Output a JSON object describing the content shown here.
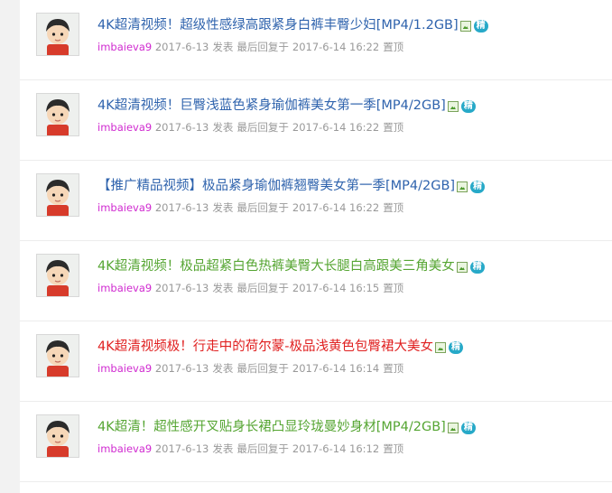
{
  "threads": [
    {
      "title": "4K超清视频！超级性感绿高跟紧身白裤丰臀少妇[MP4/1.2GB]",
      "title_color": "blue",
      "author": "imbaieva9",
      "post_date": "2017-6-13",
      "post_label": "发表",
      "last_reply_label": "最后回复于",
      "last_reply_time": "2017-6-14 16:22",
      "pin_label": "置顶",
      "digest_label": "精"
    },
    {
      "title": "4K超清视频！巨臀浅蓝色紧身瑜伽裤美女第一季[MP4/2GB]",
      "title_color": "blue",
      "author": "imbaieva9",
      "post_date": "2017-6-13",
      "post_label": "发表",
      "last_reply_label": "最后回复于",
      "last_reply_time": "2017-6-14 16:22",
      "pin_label": "置顶",
      "digest_label": "精"
    },
    {
      "title": "【推广精品视频】极品紧身瑜伽裤翘臀美女第一季[MP4/2GB]",
      "title_color": "blue",
      "author": "imbaieva9",
      "post_date": "2017-6-13",
      "post_label": "发表",
      "last_reply_label": "最后回复于",
      "last_reply_time": "2017-6-14 16:22",
      "pin_label": "置顶",
      "digest_label": "精"
    },
    {
      "title": "4K超清视频！极品超紧白色热裤美臀大长腿白高跟美三角美女",
      "title_color": "green",
      "author": "imbaieva9",
      "post_date": "2017-6-13",
      "post_label": "发表",
      "last_reply_label": "最后回复于",
      "last_reply_time": "2017-6-14 16:15",
      "pin_label": "置顶",
      "digest_label": "精"
    },
    {
      "title": "4K超清视频极！行走中的荷尔蒙-极品浅黄色包臀裙大美女",
      "title_color": "red",
      "author": "imbaieva9",
      "post_date": "2017-6-13",
      "post_label": "发表",
      "last_reply_label": "最后回复于",
      "last_reply_time": "2017-6-14 16:14",
      "pin_label": "置顶",
      "digest_label": "精"
    },
    {
      "title": "4K超清！超性感开叉贴身长裙凸显玲珑曼妙身材[MP4/2GB]",
      "title_color": "green",
      "author": "imbaieva9",
      "post_date": "2017-6-13",
      "post_label": "发表",
      "last_reply_label": "最后回复于",
      "last_reply_time": "2017-6-14 16:12",
      "pin_label": "置顶",
      "digest_label": "精"
    }
  ],
  "colors": {
    "blue": "#2f63ad",
    "green": "#55a532",
    "red": "#e02020",
    "author": "#d02bd0",
    "meta": "#999999"
  }
}
